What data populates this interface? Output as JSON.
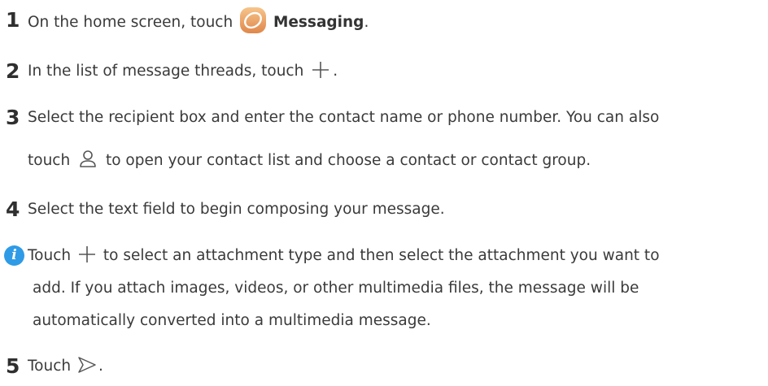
{
  "steps": [
    {
      "num": "1",
      "pre": "On the home screen, touch ",
      "app": "Messaging",
      "post": "."
    },
    {
      "num": "2",
      "pre": "In the list of message threads, touch ",
      "post": "."
    },
    {
      "num": "3",
      "line1": "Select the recipient box and enter the contact name or phone number. You can also",
      "pre": "touch ",
      "post": " to open your contact list and choose a contact or contact group."
    },
    {
      "num": "4",
      "text": "Select the text field to begin composing your message."
    },
    {
      "num": "5",
      "pre": "Touch ",
      "post": "."
    }
  ],
  "note": {
    "icon": "i",
    "pre": "Touch ",
    "post": " to select an attachment type and then select the attachment you want to",
    "line2": "add. If you attach images, videos, or other multimedia files, the message will be",
    "line3": "automatically converted into a multimedia message."
  },
  "icons": [
    "messaging-app-icon",
    "plus-icon",
    "contact-person-icon",
    "send-icon",
    "info-icon"
  ],
  "colors": {
    "accent": "#2f9be6",
    "text": "#3a3a3a",
    "messaging_icon": "#e8a35c"
  }
}
